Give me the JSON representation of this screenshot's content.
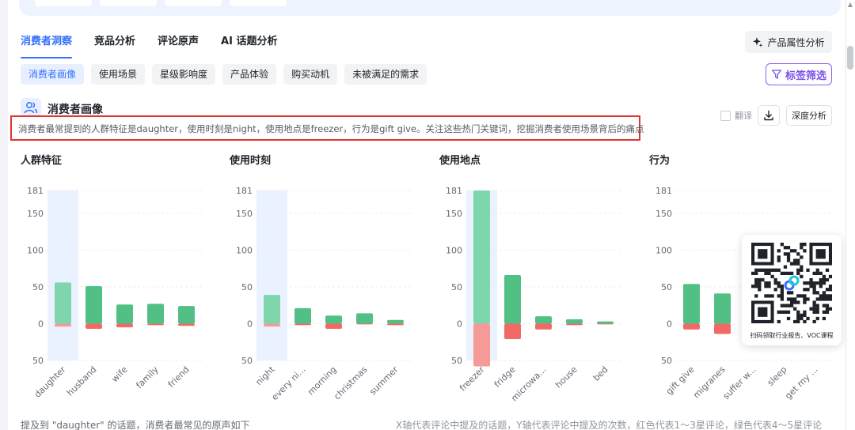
{
  "tabs": [
    {
      "label": "消费者洞察",
      "active": true
    },
    {
      "label": "竞品分析",
      "active": false
    },
    {
      "label": "评论原声",
      "active": false
    },
    {
      "label": "AI 话题分析",
      "active": false
    }
  ],
  "attr_button": {
    "label": "产品属性分析",
    "icon": "sparkle-icon"
  },
  "chips": [
    {
      "label": "消费者画像",
      "active": true
    },
    {
      "label": "使用场景",
      "active": false
    },
    {
      "label": "星级影响度",
      "active": false
    },
    {
      "label": "产品体验",
      "active": false
    },
    {
      "label": "购买动机",
      "active": false
    },
    {
      "label": "未被满足的需求",
      "active": false
    }
  ],
  "filter_button": {
    "label": "标签筛选",
    "icon": "filter-icon"
  },
  "section": {
    "title": "消费者画像",
    "icon": "users-icon",
    "summary": "消费者最常提到的人群特征是daughter，使用时刻是night，使用地点是freezer，行为是gift give。关注这些热门关键词，挖掘消费者使用场景背后的痛点"
  },
  "toolbar": {
    "translate_label": "翻译",
    "download_icon": "download-icon",
    "deep_label": "深度分析"
  },
  "colors": {
    "positive": "#52bf85",
    "positive_light": "#7fd6ac",
    "negative": "#f26a66",
    "negative_light": "#f59a96",
    "highlight": "#eaf1ff",
    "accent": "#3370ff"
  },
  "chart_data": [
    {
      "type": "bar",
      "title": "人群特征",
      "categories": [
        "daughter",
        "husband",
        "wife",
        "family",
        "friend"
      ],
      "series": [
        {
          "values": [
            56,
            51,
            26,
            27,
            24
          ]
        },
        {
          "values": [
            -4,
            -7,
            -5,
            -2,
            -3
          ]
        }
      ],
      "yticks": [
        "181",
        "150",
        "100",
        "50",
        "0",
        "50"
      ],
      "ylim": [
        -50,
        181
      ],
      "highlight_index": 0
    },
    {
      "type": "bar",
      "title": "使用时刻",
      "categories": [
        "night",
        "every ni...",
        "morning",
        "christmas",
        "summer"
      ],
      "series": [
        {
          "values": [
            39,
            21,
            11,
            14,
            5
          ]
        },
        {
          "values": [
            -4,
            -2,
            -7,
            -1,
            -2
          ]
        }
      ],
      "yticks": [
        "181",
        "150",
        "100",
        "50",
        "0",
        "50"
      ],
      "ylim": [
        -50,
        181
      ],
      "highlight_index": 0
    },
    {
      "type": "bar",
      "title": "使用地点",
      "categories": [
        "freezer",
        "fridge",
        "microwa...",
        "house",
        "bed"
      ],
      "series": [
        {
          "values": [
            181,
            66,
            10,
            6,
            3
          ]
        },
        {
          "values": [
            -58,
            -21,
            -8,
            -2,
            -1
          ]
        }
      ],
      "yticks": [
        "181",
        "150",
        "100",
        "50",
        "0",
        "50"
      ],
      "ylim": [
        -50,
        181
      ],
      "highlight_index": 0
    },
    {
      "type": "bar",
      "title": "行为",
      "categories": [
        "gift give",
        "migranes",
        "suffer w...",
        "sleep",
        "get my ..."
      ],
      "series": [
        {
          "values": [
            54,
            41,
            28,
            10,
            8
          ]
        },
        {
          "values": [
            -8,
            -14,
            -17,
            -3,
            -2
          ]
        }
      ],
      "yticks": [
        "181",
        "150",
        "100",
        "50",
        "0",
        "50"
      ],
      "ylim": [
        -50,
        181
      ],
      "highlight_index": -1
    }
  ],
  "qr": {
    "caption": "扫码领取行业报告、VOC课程"
  },
  "footer": {
    "left": "提及到 \"daughter\" 的话题，消费者最常见的原声如下",
    "right": "X轴代表评论中提及的话题，Y轴代表评论中提及的次数，红色代表1～3星评论，绿色代表4～5星评论"
  }
}
